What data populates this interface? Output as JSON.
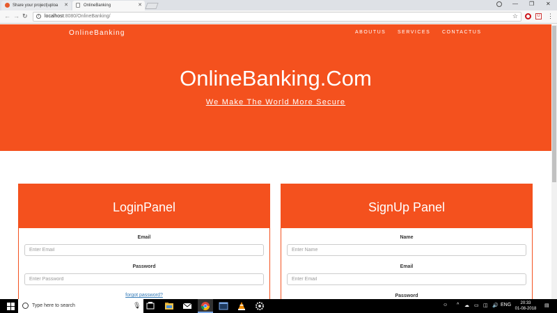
{
  "browser": {
    "tabs": [
      {
        "title": "Share your project|uploa"
      },
      {
        "title": "OnlineBanking"
      }
    ],
    "url_host": "localhost",
    "url_path": ":8080/OnlineBanking/"
  },
  "site": {
    "brand": "OnlineBanking",
    "nav": [
      "ABOUTUS",
      "SERVICES",
      "CONTACTUS"
    ],
    "hero_title": "OnlineBanking.Com",
    "hero_subtitle": "We Make The World More Secure",
    "accent_color": "#f4511e"
  },
  "login_panel": {
    "title": "LoginPanel",
    "email_label": "Email",
    "email_placeholder": "Enter Email",
    "password_label": "Password",
    "password_placeholder": "Enter Password",
    "forgot_link": "forgot password?"
  },
  "signup_panel": {
    "title": "SignUp Panel",
    "name_label": "Name",
    "name_placeholder": "Enter Name",
    "email_label": "Email",
    "email_placeholder": "Enter Email",
    "password_label": "Password"
  },
  "taskbar": {
    "search_placeholder": "Type here to search",
    "language": "ENG",
    "time": "20:33",
    "date": "01-08-2018",
    "apps": [
      "task-view-icon",
      "file-explorer-icon",
      "mail-icon",
      "chrome-icon",
      "app-window-icon",
      "vlc-icon",
      "settings-gear-icon"
    ]
  }
}
